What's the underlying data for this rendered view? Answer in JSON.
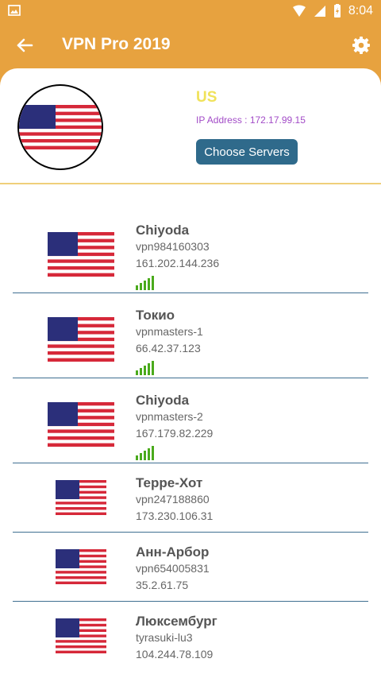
{
  "status_bar": {
    "time": "8:04"
  },
  "toolbar": {
    "title": "VPN Pro 2019",
    "back_icon": "arrow-back-icon",
    "settings_icon": "gear-icon"
  },
  "current": {
    "country": "US",
    "ip_label": "IP Address : 172.17.99.15",
    "button_label": "Choose Servers"
  },
  "servers": [
    {
      "name": "Chiyoda",
      "host": "vpn984160303",
      "ip": "161.202.144.236"
    },
    {
      "name": "Токио",
      "host": "vpnmasters-1",
      "ip": "66.42.37.123"
    },
    {
      "name": "Chiyoda",
      "host": "vpnmasters-2",
      "ip": "167.179.82.229"
    },
    {
      "name": "Терре-Хот",
      "host": "vpn247188860",
      "ip": "173.230.106.31"
    },
    {
      "name": "Анн-Арбор",
      "host": "vpn654005831",
      "ip": "35.2.61.75"
    },
    {
      "name": "Люксембург",
      "host": "tyrasuki-lu3",
      "ip": "104.244.78.109"
    }
  ],
  "colors": {
    "accent": "#e7a23f",
    "button": "#2f6a8b",
    "signal": "#4aaa1c",
    "country": "#f0e25a",
    "ip": "#a24bc7"
  }
}
